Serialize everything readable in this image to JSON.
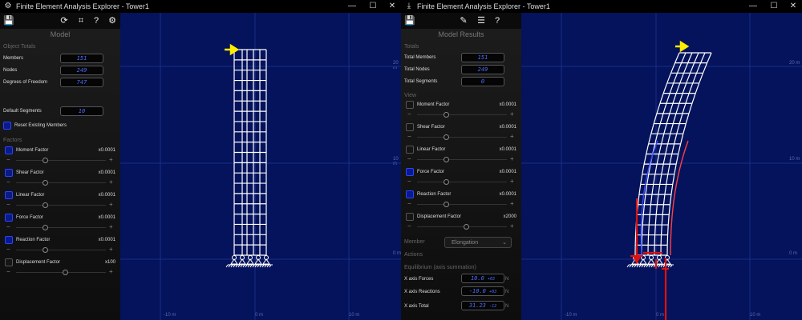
{
  "left": {
    "title": "Finite Element Analysis Explorer - Tower1",
    "panel_title": "Model",
    "section_totals": "Object Totals",
    "members_label": "Members",
    "members_value": "151",
    "nodes_label": "Nodes",
    "nodes_value": "249",
    "dof_label": "Degrees of Freedom",
    "dof_value": "747",
    "segments_label": "Default Segments",
    "segments_value": "10",
    "reset_label": "Reset Existing Members",
    "section_factors": "Factors",
    "factors": [
      {
        "label": "Moment Factor",
        "value": "x0.0001",
        "checked": true
      },
      {
        "label": "Shear Factor",
        "value": "x0.0001",
        "checked": true
      },
      {
        "label": "Linear Factor",
        "value": "x0.0001",
        "checked": true
      },
      {
        "label": "Force Factor",
        "value": "x0.0001",
        "checked": true
      },
      {
        "label": "Reaction Factor",
        "value": "x0.0001",
        "checked": true
      },
      {
        "label": "Displacement Factor",
        "value": "x100",
        "checked": false
      }
    ],
    "axis": {
      "y20": "20 m",
      "y10": "10 m",
      "y0": "0 m",
      "xm10": "-10 m",
      "x0": "0 m",
      "x10": "10 m"
    }
  },
  "right": {
    "title": "Finite Element Analysis Explorer - Tower1",
    "panel_title": "Model Results",
    "section_totals": "Totals",
    "members_label": "Total Members",
    "members_value": "151",
    "nodes_label": "Total Nodes",
    "nodes_value": "249",
    "segments_label": "Total Segments",
    "segments_value": "0",
    "section_view": "View",
    "factors": [
      {
        "label": "Moment Factor",
        "value": "x0.0001",
        "checked": false
      },
      {
        "label": "Shear Factor",
        "value": "x0.0001",
        "checked": false
      },
      {
        "label": "Linear Factor",
        "value": "x0.0001",
        "checked": false
      },
      {
        "label": "Force Factor",
        "value": "x0.0001",
        "checked": true
      },
      {
        "label": "Reaction Factor",
        "value": "x0.0001",
        "checked": true
      },
      {
        "label": "Displacement Factor",
        "value": "x2000",
        "checked": false
      }
    ],
    "member_label": "Member",
    "member_dropdown": "Elongation",
    "actions_label": "Actions",
    "section_equilibrium": "Equilibrium (axis summation)",
    "x_forces_label": "X axis Forces",
    "x_forces_value": "10.0",
    "x_forces_exp": "+03",
    "x_forces_unit": "N",
    "x_reactions_label": "X axis Reactions",
    "x_reactions_value": "-10.0",
    "x_reactions_exp": "+03",
    "x_reactions_unit": "N",
    "x_total_label": "X axis Total",
    "x_total_value": "31.23",
    "x_total_exp": "-12",
    "x_total_unit": "N",
    "axis": {
      "y20": "20 m",
      "y10": "10 m",
      "y0": "0 m",
      "xm10": "-10 m",
      "x0": "0 m",
      "x10": "10 m"
    }
  },
  "colors": {
    "canvas": "#04135c",
    "structure": "#ffffff",
    "force_arrow": "#ffee00",
    "reaction": "#e01010",
    "value_text": "#4f6bff"
  }
}
